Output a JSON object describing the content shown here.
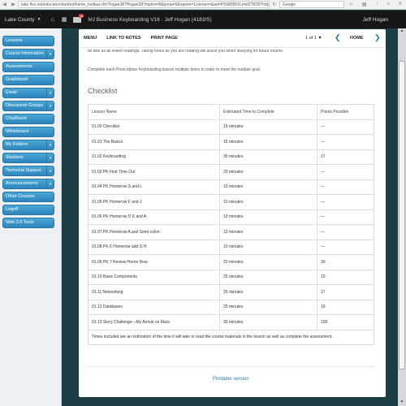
{
  "browser": {
    "url": "lake.flvs.net/educator/student/frame_toolbar.cfm?logan38?Hogan38?mploo=8&pooa=0&option=1clemen=&ad=P59d5B01Limit2?R30?http://",
    "search_placeholder": "Google"
  },
  "topbar": {
    "county": "Lake County",
    "mail_badge": "18",
    "course": "MJ Business Keyboarding V16 · Jeff Hogan (4183/S)",
    "user": "Jeff Hogan"
  },
  "sidebar": {
    "items": [
      {
        "label": "Lessons",
        "arrow": false
      },
      {
        "label": "Course Information",
        "arrow": true
      },
      {
        "label": "Assessments",
        "arrow": false
      },
      {
        "label": "Gradebook",
        "arrow": false
      },
      {
        "label": "Email",
        "arrow": true
      },
      {
        "label": "Discussion Groups",
        "arrow": true
      },
      {
        "label": "ChatRoom",
        "arrow": false
      },
      {
        "label": "Whiteboard",
        "arrow": false
      },
      {
        "label": "My Folders",
        "arrow": true
      },
      {
        "label": "Students",
        "arrow": true
      },
      {
        "label": "Technical Support",
        "arrow": true
      },
      {
        "label": "Announcements",
        "arrow": true
      },
      {
        "label": "Other Courses",
        "arrow": false
      },
      {
        "label": "Logoff",
        "arrow": false
      },
      {
        "label": "Web 2.0 Tools",
        "arrow": false
      }
    ]
  },
  "toolbar": {
    "menu": "MENU",
    "link_to_notes": "LINK TO NOTES",
    "print_page": "PRINT PAGE",
    "page": "1 of 1 ▼",
    "home": "HOME"
  },
  "content": {
    "intro1": "as well as all linked readings. Taking notes as you are reading will assist you when studying for future exams.",
    "intro2": "Complete each Prescriptive Keyboarding lesson multiple times in order to meet the module goal.",
    "heading": "Checklist",
    "table": {
      "headers": [
        "Lesson Name",
        "Estimated Time to Complete",
        "Points Possible"
      ],
      "rows": [
        [
          "01.00 Checklist",
          "15 minutes",
          "—"
        ],
        [
          "01.01 The Basics",
          "15 minutes",
          "—"
        ],
        [
          "01.02 Keyboarding",
          "30 minutes",
          "17"
        ],
        [
          "01.03 PK First Time Out",
          "20 minutes",
          "—"
        ],
        [
          "01.04 PK Homerow S and L",
          "10 minutes",
          "—"
        ],
        [
          "01.05 PK Homerow F and J",
          "10 minutes",
          "—"
        ],
        [
          "01.06 PK Homerow D K and A",
          "10 minutes",
          "—"
        ],
        [
          "01.07 PK Homerow A and Semi-colon",
          "10 minutes",
          "—"
        ],
        [
          "01.08 PK 6 Homerow add G H",
          "10 minutes",
          "—"
        ],
        [
          "01.09 PK 7 Review Home Row",
          "20 minutes",
          "30"
        ],
        [
          "01.10 Basic Components",
          "25 minutes",
          "10"
        ],
        [
          "01.11 Networking",
          "25 minutes",
          "17"
        ],
        [
          "01.12 Databases",
          "25 minutes",
          "19"
        ],
        [
          "01.13 Story Challenge—My Arrival on Mars",
          "30 minutes",
          "100"
        ]
      ],
      "note": "Times included are an estimation of the time it will take to read the course materials in the lesson as well as complete the assessment."
    },
    "printable": "Printable version"
  }
}
